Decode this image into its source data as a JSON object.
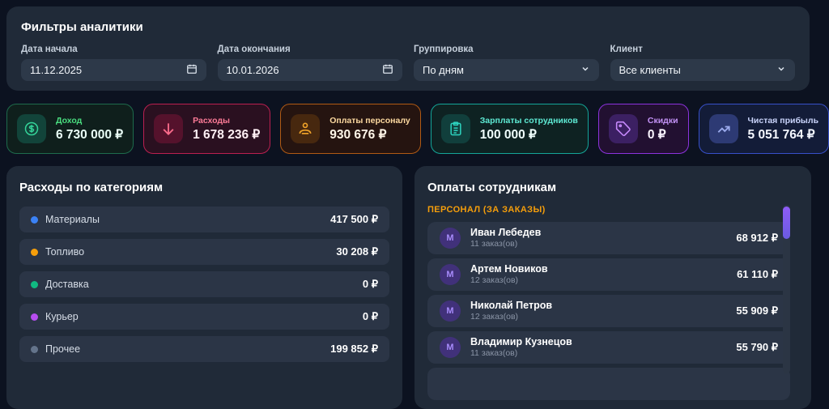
{
  "filters": {
    "title": "Фильтры аналитики",
    "fields": [
      {
        "label": "Дата начала",
        "type": "date",
        "value": "11.12.2025"
      },
      {
        "label": "Дата окончания",
        "type": "date",
        "value": "10.01.2026"
      },
      {
        "label": "Группировка",
        "type": "select",
        "value": "По дням"
      },
      {
        "label": "Клиент",
        "type": "select",
        "value": "Все клиенты"
      }
    ]
  },
  "stats": [
    {
      "label": "Доход",
      "value": "6 730 000 ₽",
      "icon": "dollar-circle-icon",
      "accent": "#34d399"
    },
    {
      "label": "Расходы",
      "value": "1 678 236 ₽",
      "icon": "arrow-down-icon",
      "accent": "#fb6b8b"
    },
    {
      "label": "Оплаты персоналу",
      "value": "930 676 ₽",
      "icon": "worker-icon",
      "accent": "#f0a32a"
    },
    {
      "label": "Зарплаты сотрудников",
      "value": "100 000 ₽",
      "icon": "clipboard-icon",
      "accent": "#2dd4bf"
    },
    {
      "label": "Скидки",
      "value": "0 ₽",
      "icon": "tag-icon",
      "accent": "#c689fc"
    },
    {
      "label": "Чистая прибыль",
      "value": "5 051 764 ₽",
      "icon": "trending-up-icon",
      "accent": "#9cabee"
    }
  ],
  "expenses_panel": {
    "title": "Расходы по категориям",
    "items": [
      {
        "label": "Материалы",
        "value": "417 500 ₽",
        "dot_color": "#3b82f6"
      },
      {
        "label": "Топливо",
        "value": "30 208 ₽",
        "dot_color": "#f59e0b"
      },
      {
        "label": "Доставка",
        "value": "0 ₽",
        "dot_color": "#10b981"
      },
      {
        "label": "Курьер",
        "value": "0 ₽",
        "dot_color": "#b64df0"
      },
      {
        "label": "Прочее",
        "value": "199 852 ₽",
        "dot_color": "#64748b"
      }
    ]
  },
  "payments_panel": {
    "title": "Оплаты сотрудникам",
    "section_label": "ПЕРСОНАЛ (ЗА ЗАКАЗЫ)",
    "employees": [
      {
        "initial": "М",
        "name": "Иван Лебедев",
        "orders": "11 заказ(ов)",
        "value": "68 912 ₽"
      },
      {
        "initial": "М",
        "name": "Артем Новиков",
        "orders": "12 заказ(ов)",
        "value": "61 110 ₽"
      },
      {
        "initial": "М",
        "name": "Николай Петров",
        "orders": "12 заказ(ов)",
        "value": "55 909 ₽"
      },
      {
        "initial": "М",
        "name": "Владимир Кузнецов",
        "orders": "11 заказ(ов)",
        "value": "55 790 ₽"
      }
    ],
    "scrollbar_thumb_color": "#8f5cf7"
  }
}
